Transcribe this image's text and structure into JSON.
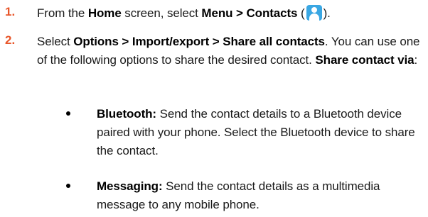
{
  "steps": [
    {
      "number": "1.",
      "parts": {
        "t1": "From the ",
        "b1": "Home",
        "t2": " screen, select ",
        "b2": "Menu > Contacts",
        "t3": " (",
        "icon": "contacts-icon",
        "t4": ")."
      }
    },
    {
      "number": "2.",
      "parts": {
        "t1": "Select ",
        "b1": "Options > Import/export  > Share all contacts",
        "t2": ". You can use one of the following options to share the desired contact. ",
        "b2": "Share contact via",
        "t3": ":"
      }
    }
  ],
  "options": [
    {
      "label": "Bluetooth:",
      "text": " Send the contact details to a Bluetooth device paired with your phone. Select the Bluetooth device to share the contact."
    },
    {
      "label": "Messaging:",
      "text": " Send the contact details as a multimedia message to any mobile phone."
    }
  ],
  "colors": {
    "step_number": "#e8562a",
    "contacts_icon_bg": "#3aa7e3"
  }
}
